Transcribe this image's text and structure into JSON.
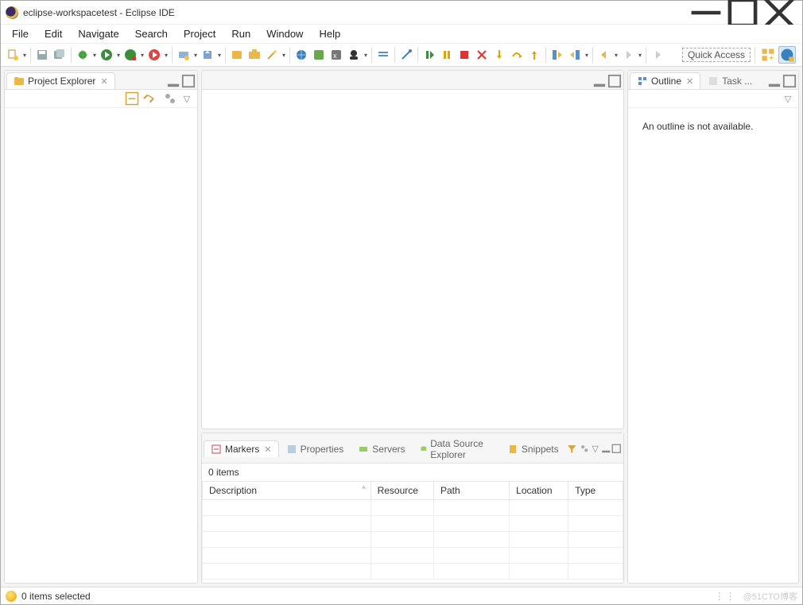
{
  "window": {
    "title": "eclipse-workspacetest - Eclipse IDE"
  },
  "menu": [
    "File",
    "Edit",
    "Navigate",
    "Search",
    "Project",
    "Run",
    "Window",
    "Help"
  ],
  "quick_access": {
    "label": "Quick Access"
  },
  "views": {
    "project_explorer": {
      "title": "Project Explorer"
    },
    "outline": {
      "title": "Outline",
      "task_tab": "Task ...",
      "message": "An outline is not available."
    },
    "markers": {
      "title": "Markers",
      "other_tabs": [
        "Properties",
        "Servers",
        "Data Source Explorer",
        "Snippets"
      ],
      "count_text": "0 items",
      "columns": [
        "Description",
        "Resource",
        "Path",
        "Location",
        "Type"
      ]
    }
  },
  "status": {
    "text": "0 items selected",
    "watermark": "@51CTO博客"
  }
}
